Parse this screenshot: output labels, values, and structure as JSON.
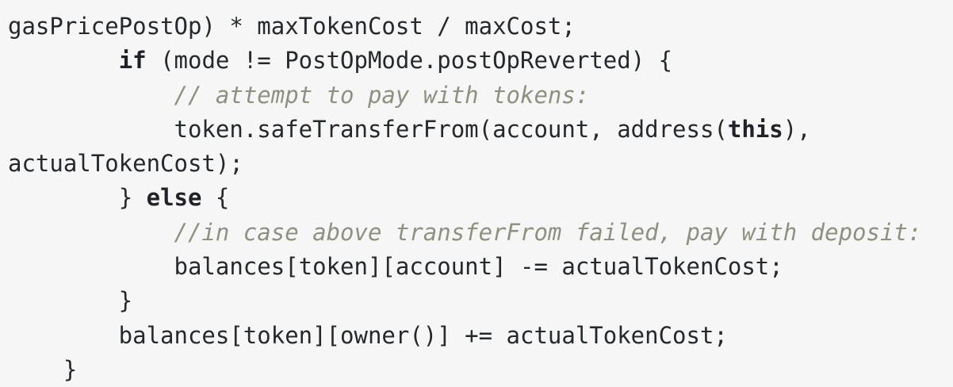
{
  "code": {
    "line1": "gasPricePostOp) * maxTokenCost / maxCost;",
    "line2": {
      "indent": "        ",
      "kw": "if",
      "rest": " (mode != PostOpMode.postOpReverted) {"
    },
    "line3": {
      "indent": "            ",
      "comment": "// attempt to pay with tokens:"
    },
    "line4": {
      "indent": "            ",
      "pre": "token.safeTransferFrom(account, address(",
      "kw": "this",
      "post": "),"
    },
    "line5": "actualTokenCost);",
    "line6": {
      "indent": "        ",
      "pre": "} ",
      "kw": "else",
      "post": " {"
    },
    "line7": {
      "indent": "            ",
      "comment": "//in case above transferFrom failed, pay with deposit:"
    },
    "line8": "            balances[token][account] -= actualTokenCost;",
    "line9": "        }",
    "line10": "        balances[token][owner()] += actualTokenCost;",
    "line11": "    }"
  }
}
